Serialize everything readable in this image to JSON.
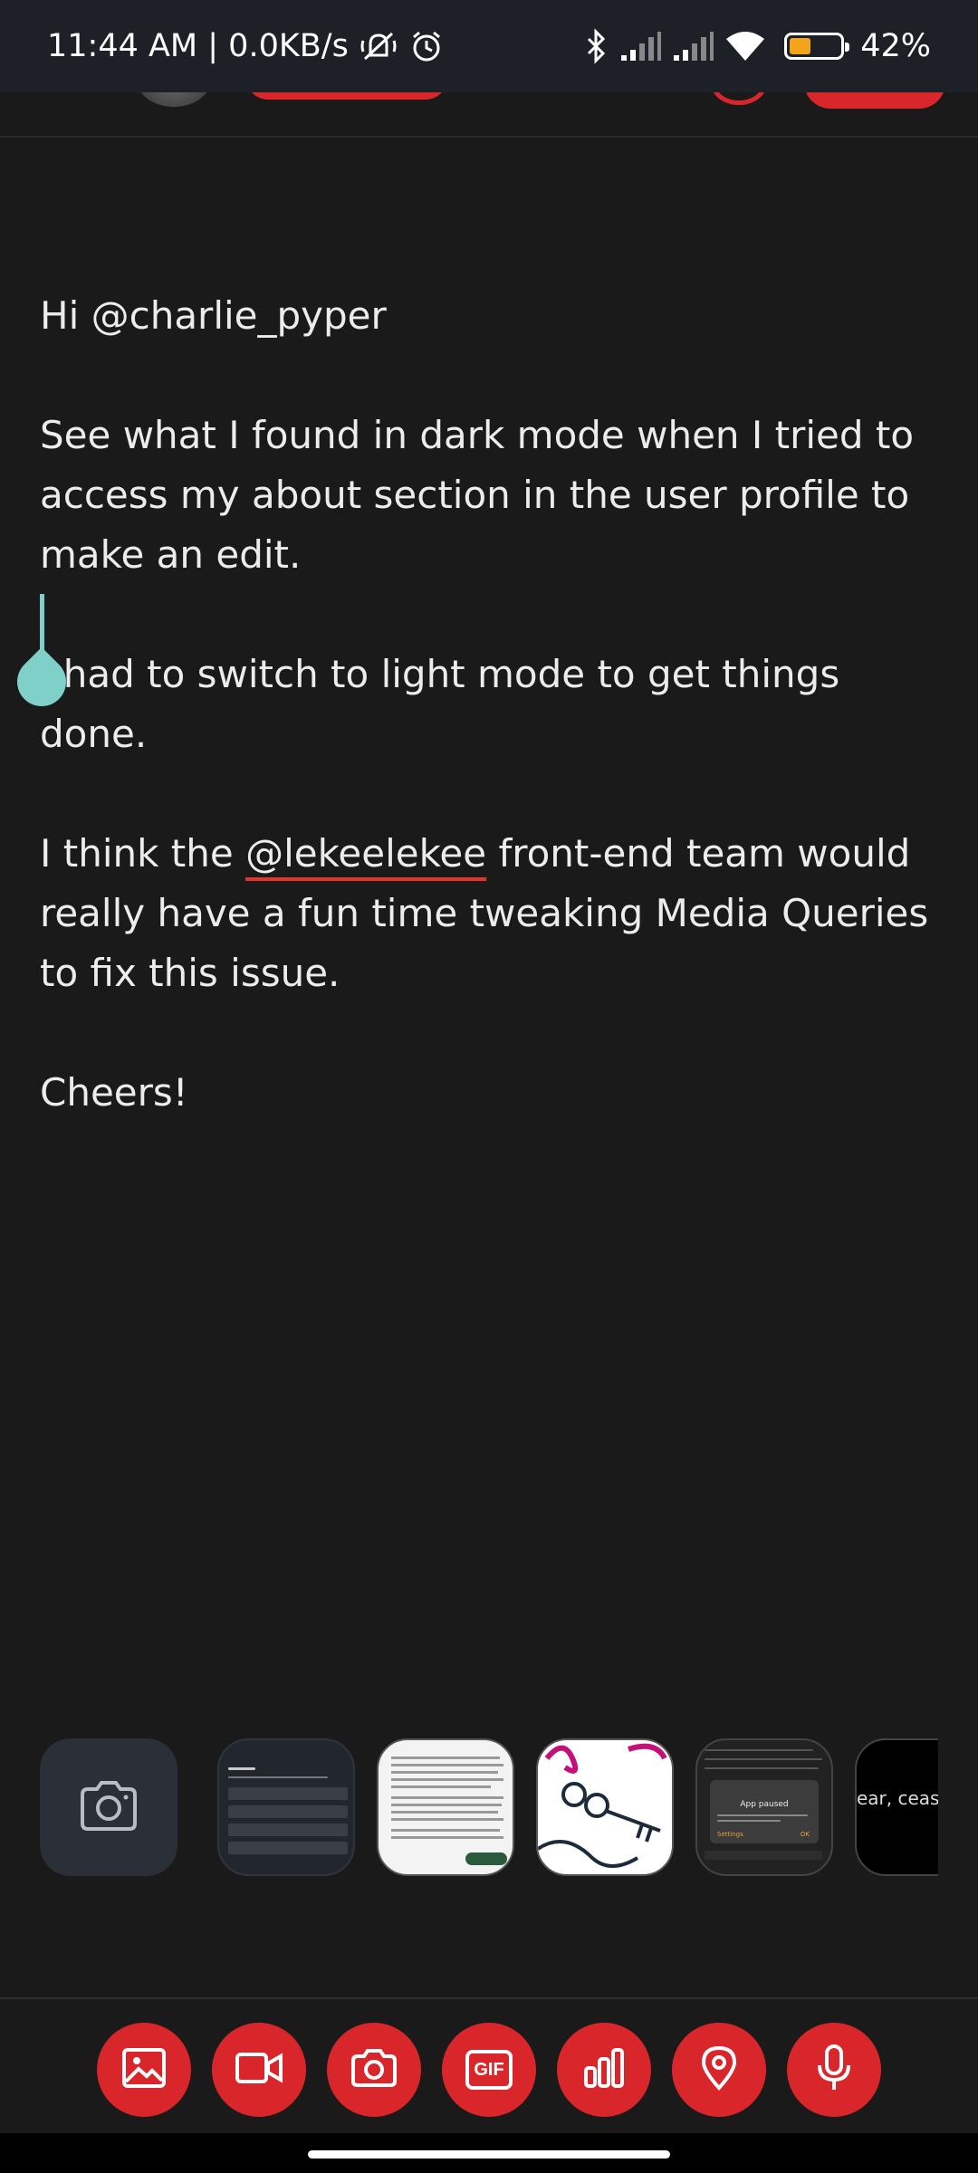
{
  "status_bar": {
    "time_speed": "11:44 AM | 0.0KB/s",
    "battery_percent": "42%",
    "battery_level": 0.42,
    "icons": [
      "mute-alarm-icon",
      "alarm-icon",
      "bluetooth-icon",
      "signal-icon",
      "signal-icon",
      "wifi-icon",
      "battery-icon"
    ]
  },
  "compose": {
    "greeting": "Hi @charlie_pyper",
    "para1": "See what I found in dark mode when I tried to access my about section in the user profile to make an edit.",
    "para2": "I had to switch to light mode to get things done.",
    "para3_before": "I think the ",
    "para3_mention": "@lekeelekee",
    "para3_after": " front-end team would really have a fun time tweaking Media Queries to fix this issue.",
    "closing": "Cheers!"
  },
  "media_strip": {
    "camera_icon": "camera-icon",
    "thumb_partial_text": "ear, ceasa",
    "thumb_dialog_title": "App paused",
    "thumb_dialog_settings": "Settings",
    "thumb_dialog_ok": "OK"
  },
  "actions": [
    {
      "name": "image-icon"
    },
    {
      "name": "video-icon"
    },
    {
      "name": "camera-icon"
    },
    {
      "name": "gif-icon",
      "label": "GIF"
    },
    {
      "name": "poll-icon"
    },
    {
      "name": "location-icon"
    },
    {
      "name": "microphone-icon"
    }
  ],
  "colors": {
    "accent": "#d9262a",
    "background": "#1a1a1a",
    "cursor": "#7ed0c8",
    "statusbar": "#1e2027"
  }
}
